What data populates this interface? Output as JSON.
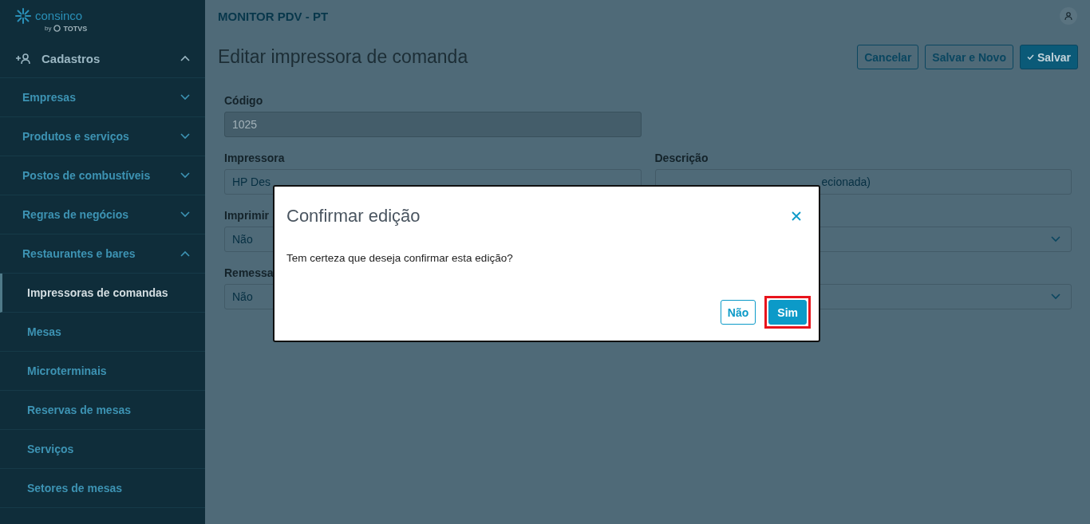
{
  "logo": {
    "name": "consinco",
    "by": "by",
    "brand": "TOTVS"
  },
  "sidebar": {
    "section": {
      "label": "Cadastros",
      "expanded": true
    },
    "items": [
      {
        "label": "Empresas",
        "expanded": false
      },
      {
        "label": "Produtos e serviços",
        "expanded": false
      },
      {
        "label": "Postos de combustíveis",
        "expanded": false
      },
      {
        "label": "Regras de negócios",
        "expanded": false
      },
      {
        "label": "Restaurantes e bares",
        "expanded": true,
        "children": [
          {
            "label": "Impressoras de comandas",
            "selected": true
          },
          {
            "label": "Mesas",
            "selected": false
          },
          {
            "label": "Microterminais",
            "selected": false
          },
          {
            "label": "Reservas de mesas",
            "selected": false
          },
          {
            "label": "Serviços",
            "selected": false
          },
          {
            "label": "Setores de mesas",
            "selected": false
          }
        ]
      }
    ]
  },
  "header": {
    "app_title": "MONITOR PDV - PT"
  },
  "page": {
    "title": "Editar impressora de comanda",
    "buttons": [
      {
        "label": "Cancelar",
        "kind": "outline"
      },
      {
        "label": "Salvar e Novo",
        "kind": "outline"
      },
      {
        "label": "Salvar",
        "kind": "primary"
      }
    ]
  },
  "form": {
    "rows": [
      [
        {
          "label": "Código",
          "value": "1025",
          "kind": "text",
          "disabled": true
        }
      ],
      [
        {
          "label": "Impressora",
          "value": "HP Des",
          "kind": "text",
          "disabled": false
        },
        {
          "label": "Descrição",
          "value": "ecionada)",
          "kind": "text",
          "disabled": false
        }
      ],
      [
        {
          "label": "Imprimir",
          "value": "Não",
          "kind": "select",
          "disabled": false
        },
        {
          "kind": "select",
          "disabled": false
        }
      ],
      [
        {
          "label": "Remessa",
          "value": "Não",
          "kind": "select",
          "disabled": false
        },
        {
          "kind": "select",
          "disabled": false
        }
      ]
    ]
  },
  "dialog": {
    "title": "Confirmar edição",
    "message": "Tem certeza que deseja confirmar esta edição?",
    "buttons": [
      {
        "label": "Não",
        "kind": "outline",
        "highlighted": false
      },
      {
        "label": "Sim",
        "kind": "primary",
        "highlighted": true
      }
    ]
  }
}
